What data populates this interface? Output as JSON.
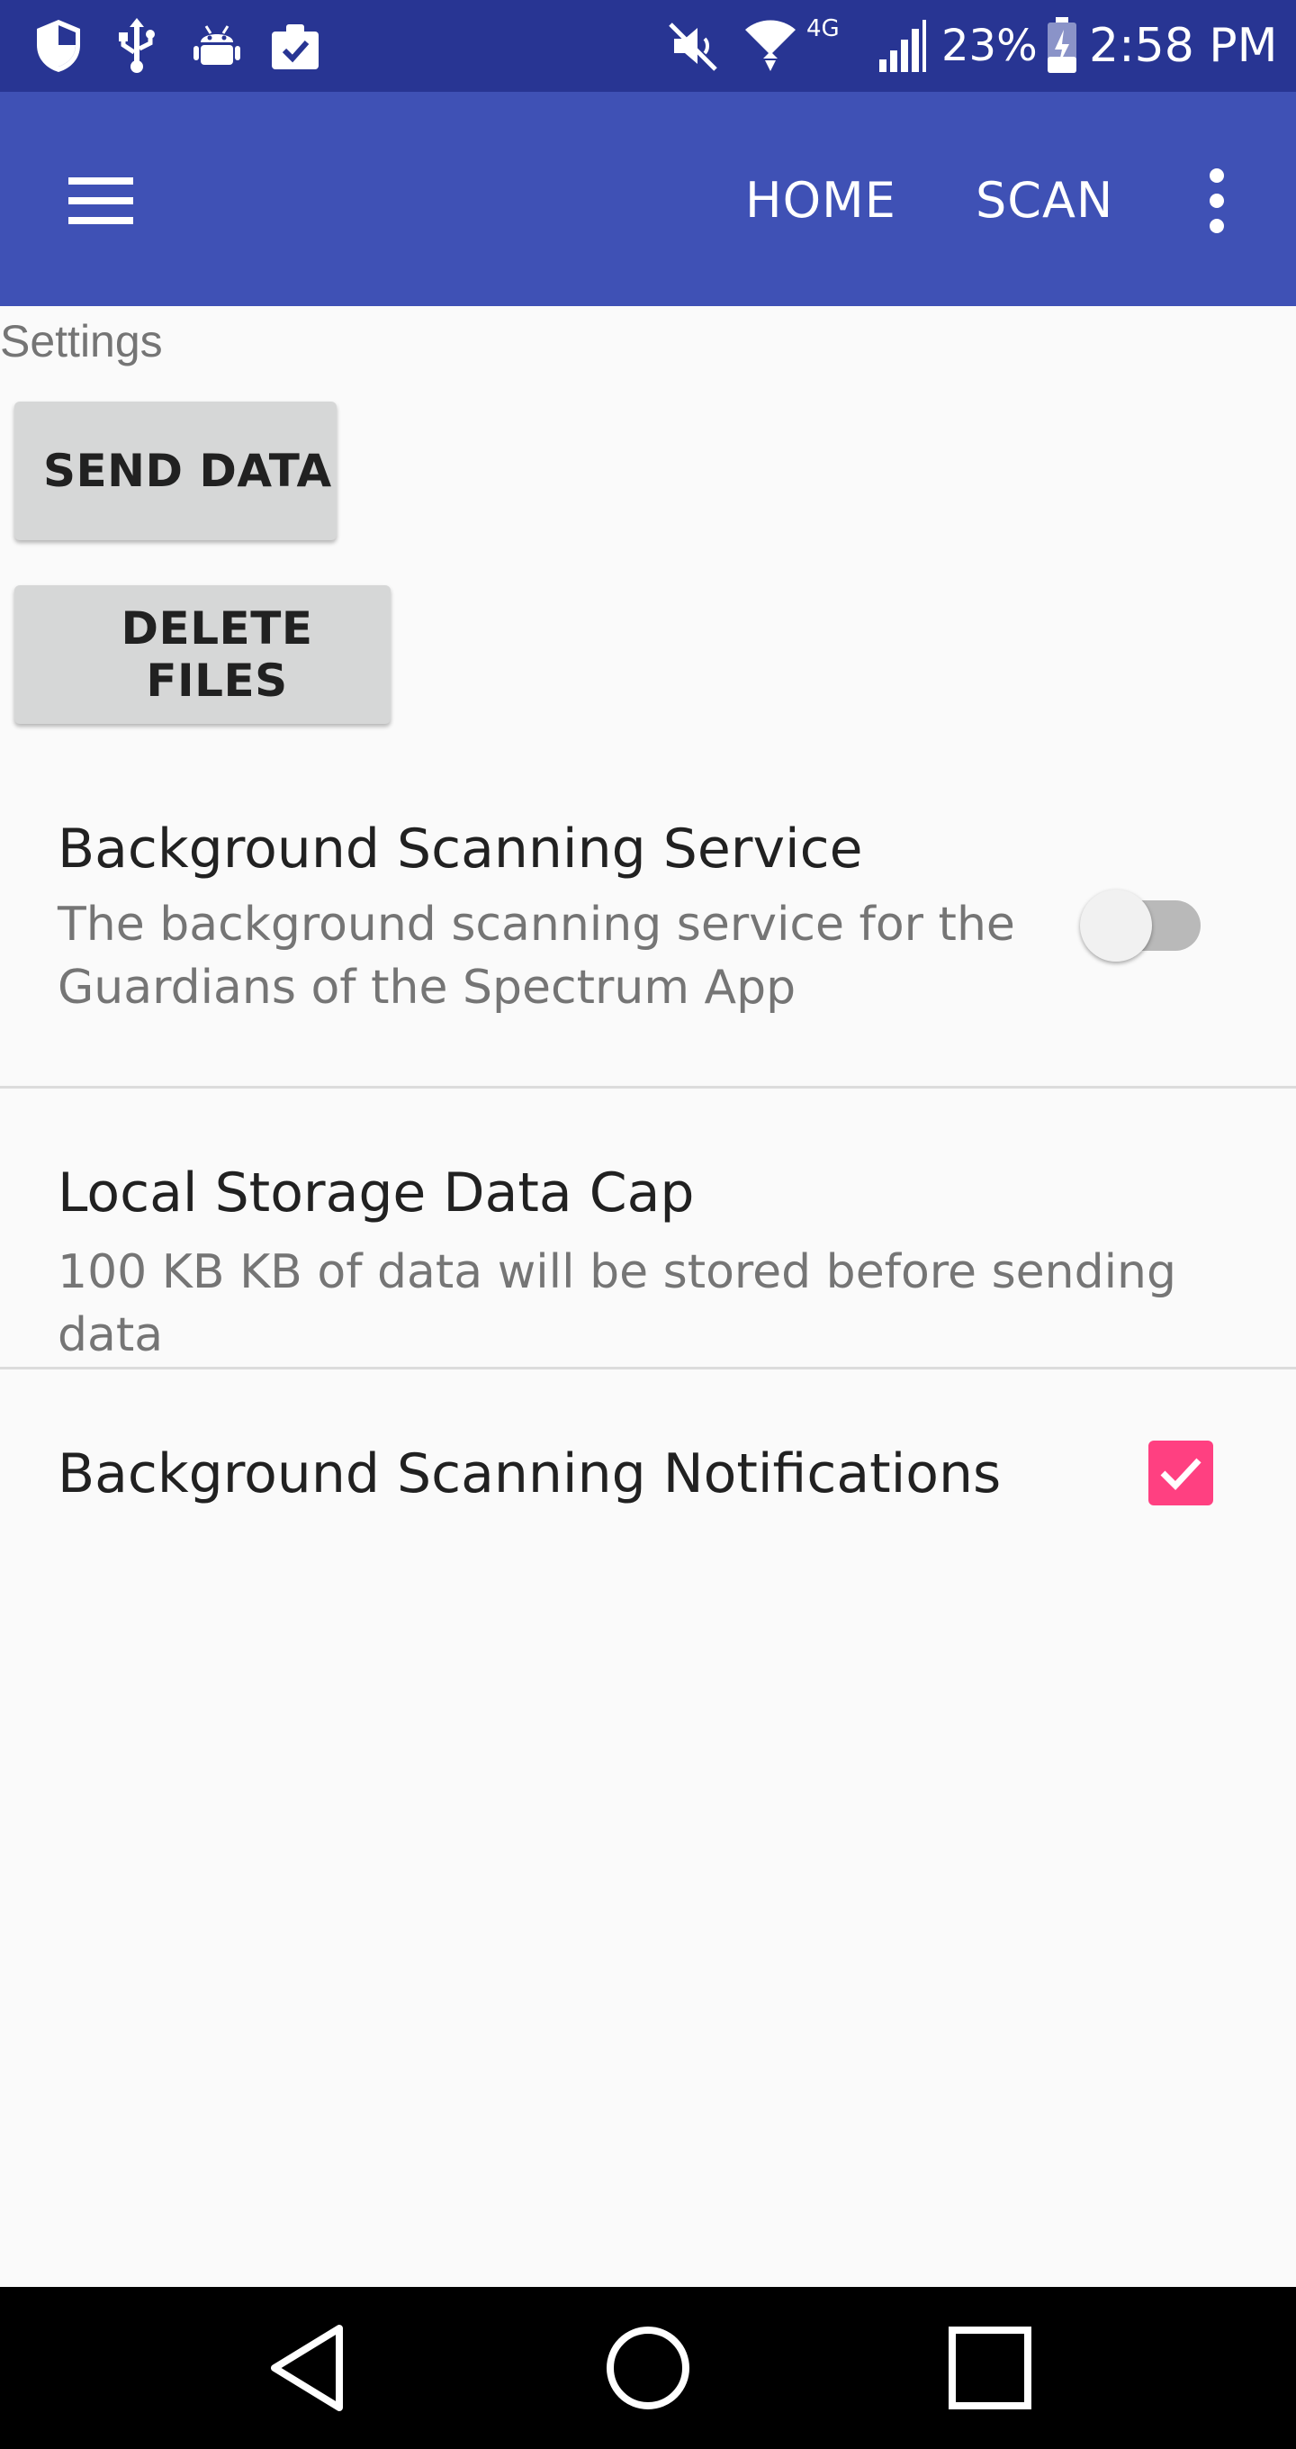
{
  "status_bar": {
    "network": "4G",
    "battery": "23%",
    "time": "2:58 PM",
    "icons": [
      "shield-icon",
      "usb-icon",
      "android-debug-icon",
      "clipboard-check-icon",
      "mute-icon",
      "wifi-icon",
      "signal-icon",
      "battery-charging-icon"
    ]
  },
  "app_bar": {
    "menu_icon": "hamburger-menu-icon",
    "actions": [
      "HOME",
      "SCAN"
    ],
    "overflow_icon": "more-vert-icon",
    "color": "#3f51b5",
    "status_color": "#283593"
  },
  "content": {
    "section_label": "Settings",
    "buttons": {
      "send_data": "SEND DATA",
      "delete_files": "DELETE FILES"
    },
    "preferences": [
      {
        "title": "Background Scanning Service",
        "summary_line1": "The background scanning service for the",
        "summary_line2": "Guardians of the Spectrum App",
        "control": "switch",
        "checked": false
      },
      {
        "title": "Local Storage Data Cap",
        "summary_line1": "100 KB KB of data will be stored before sending data"
      },
      {
        "title": "Background Scanning Notifications",
        "control": "checkbox",
        "checked": true
      }
    ],
    "accent_color": "#ff4081"
  },
  "nav_bar": {
    "icons": [
      "back-icon",
      "home-icon",
      "recents-icon"
    ]
  }
}
